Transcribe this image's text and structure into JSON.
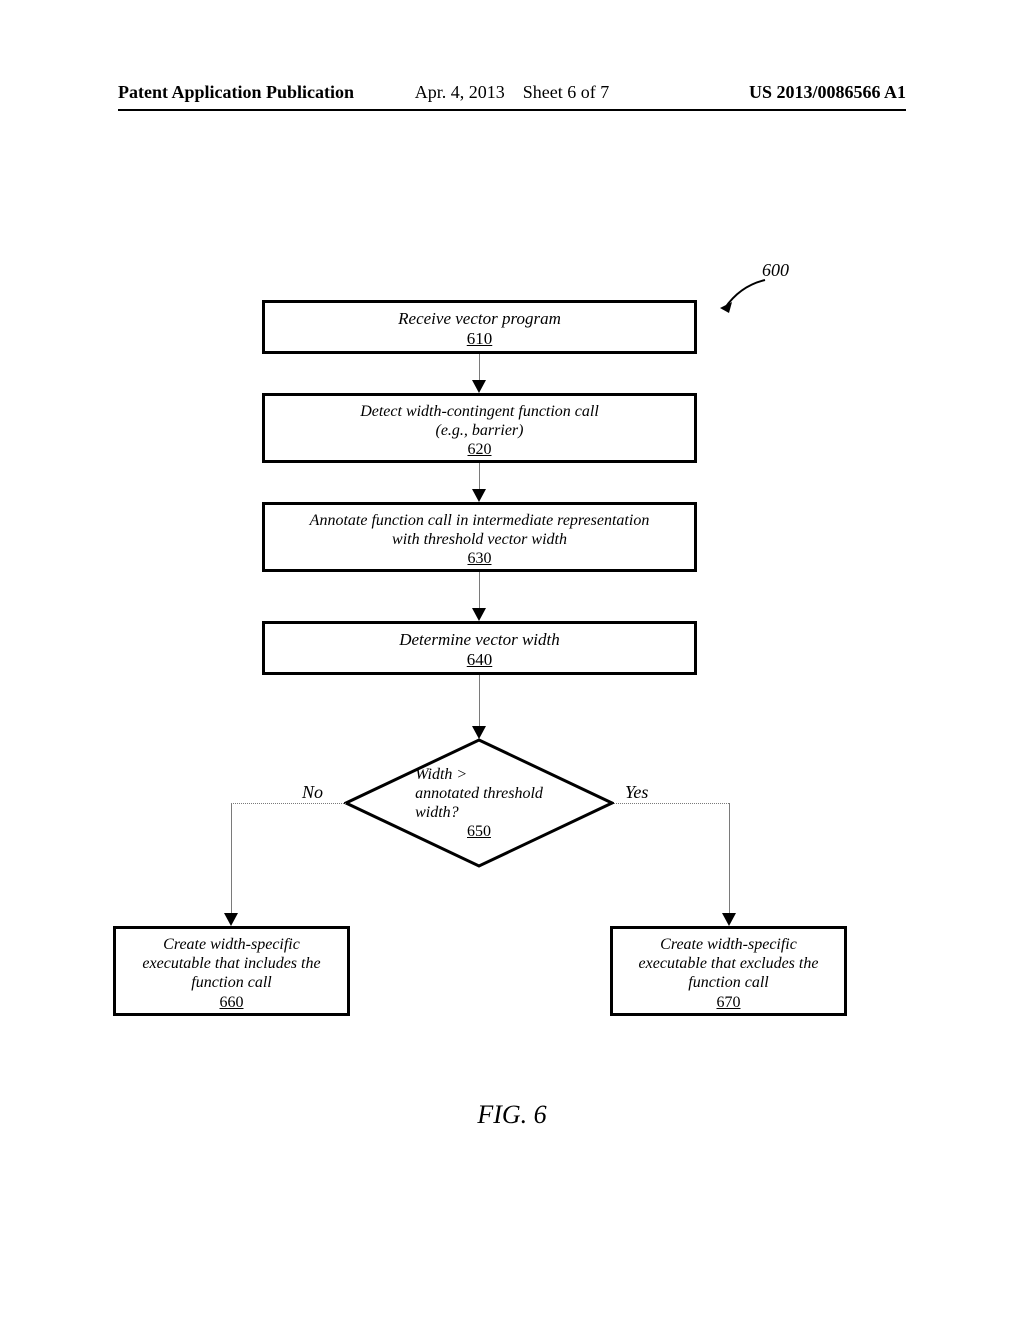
{
  "header": {
    "left": "Patent Application Publication",
    "center_date": "Apr. 4, 2013",
    "center_sheet": "Sheet 6 of 7",
    "right": "US 2013/0086566 A1"
  },
  "figure_label": "FIG. 6",
  "chart_data": {
    "type": "flowchart",
    "reference": "600",
    "nodes": [
      {
        "id": "610",
        "type": "process",
        "text": "Receive vector program"
      },
      {
        "id": "620",
        "type": "process",
        "text": "Detect width-contingent function call (e.g., barrier)"
      },
      {
        "id": "630",
        "type": "process",
        "text": "Annotate function call in intermediate representation with threshold vector width"
      },
      {
        "id": "640",
        "type": "process",
        "text": "Determine vector width"
      },
      {
        "id": "650",
        "type": "decision",
        "text": "Width > annotated threshold width?"
      },
      {
        "id": "660",
        "type": "process",
        "text": "Create width-specific executable that includes the function call"
      },
      {
        "id": "670",
        "type": "process",
        "text": "Create width-specific executable that excludes the function call"
      }
    ],
    "edges": [
      {
        "from": "610",
        "to": "620"
      },
      {
        "from": "620",
        "to": "630"
      },
      {
        "from": "630",
        "to": "640"
      },
      {
        "from": "640",
        "to": "650"
      },
      {
        "from": "650",
        "to": "660",
        "label": "No"
      },
      {
        "from": "650",
        "to": "670",
        "label": "Yes"
      }
    ]
  },
  "labels": {
    "no": "No",
    "yes": "Yes"
  }
}
